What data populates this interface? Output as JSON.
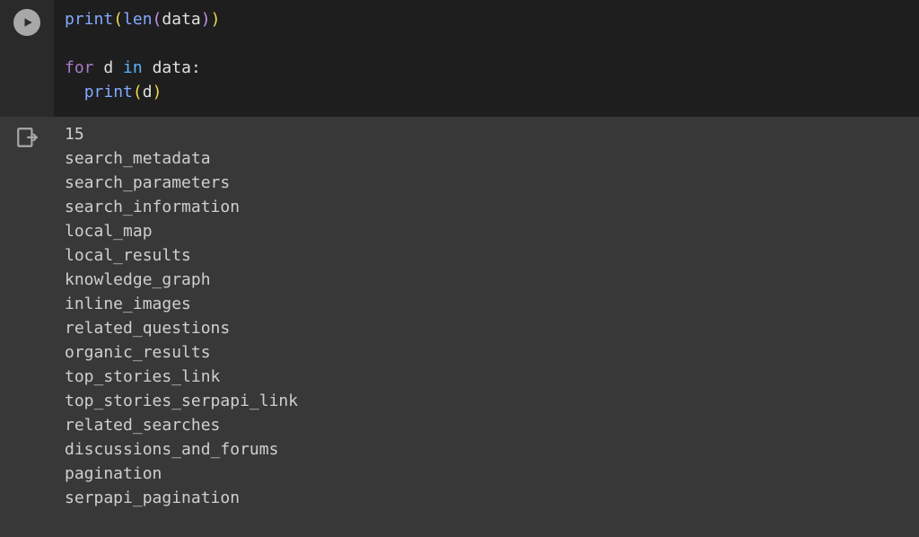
{
  "code": {
    "lines": [
      {
        "type": "code",
        "segments": [
          {
            "cls": "tok-fn",
            "text": "print"
          },
          {
            "cls": "tok-paren-yellow",
            "text": "("
          },
          {
            "cls": "tok-builtin",
            "text": "len"
          },
          {
            "cls": "tok-paren-purple",
            "text": "("
          },
          {
            "cls": "tok-var",
            "text": "data"
          },
          {
            "cls": "tok-paren-purple",
            "text": ")"
          },
          {
            "cls": "tok-paren-yellow",
            "text": ")"
          }
        ]
      },
      {
        "type": "blank"
      },
      {
        "type": "code",
        "segments": [
          {
            "cls": "tok-kw",
            "text": "for"
          },
          {
            "cls": "",
            "text": " "
          },
          {
            "cls": "tok-var",
            "text": "d"
          },
          {
            "cls": "",
            "text": " "
          },
          {
            "cls": "tok-kw2",
            "text": "in"
          },
          {
            "cls": "",
            "text": " "
          },
          {
            "cls": "tok-var",
            "text": "data"
          },
          {
            "cls": "tok-colon",
            "text": ":"
          }
        ]
      },
      {
        "type": "code",
        "segments": [
          {
            "cls": "",
            "text": "  "
          },
          {
            "cls": "tok-fn",
            "text": "print"
          },
          {
            "cls": "tok-paren-yellow",
            "text": "("
          },
          {
            "cls": "tok-var",
            "text": "d"
          },
          {
            "cls": "tok-paren-yellow",
            "text": ")"
          }
        ]
      }
    ]
  },
  "output": {
    "lines": [
      "15",
      "search_metadata",
      "search_parameters",
      "search_information",
      "local_map",
      "local_results",
      "knowledge_graph",
      "inline_images",
      "related_questions",
      "organic_results",
      "top_stories_link",
      "top_stories_serpapi_link",
      "related_searches",
      "discussions_and_forums",
      "pagination",
      "serpapi_pagination"
    ]
  }
}
